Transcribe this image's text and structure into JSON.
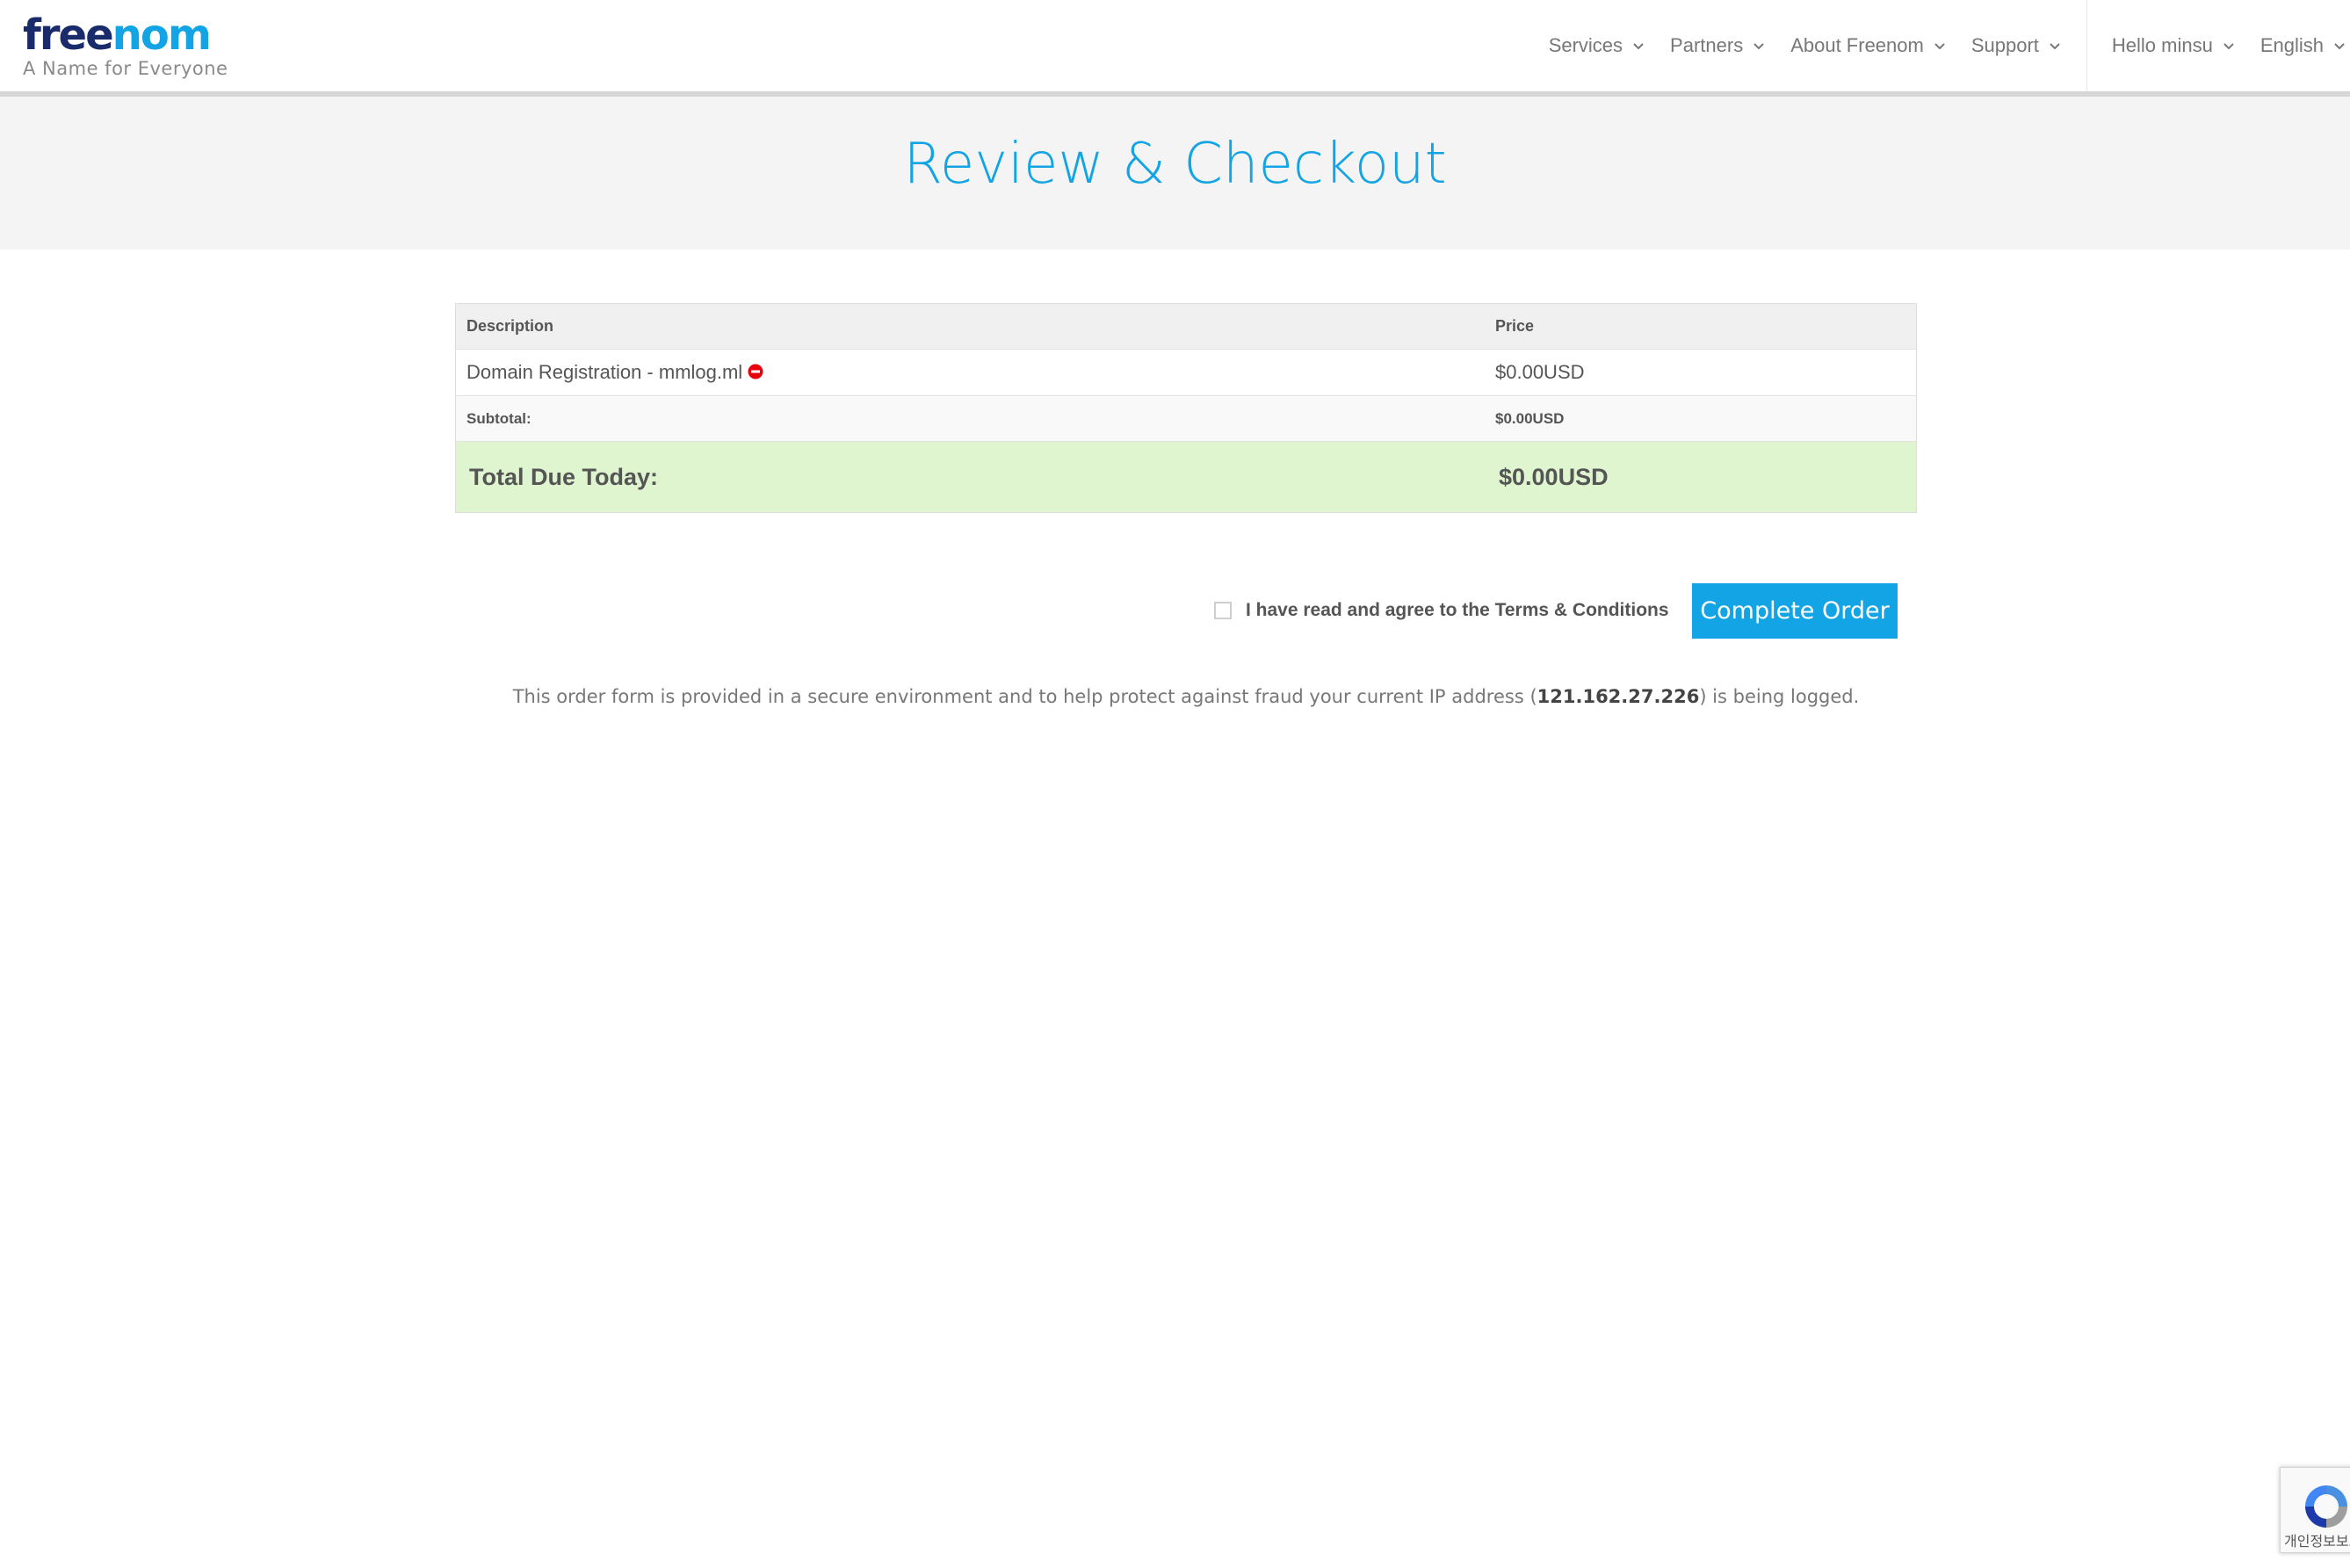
{
  "header": {
    "logo_part1": "free",
    "logo_part2": "nom",
    "tagline": "A Name for Everyone",
    "nav": [
      {
        "label": "Services"
      },
      {
        "label": "Partners"
      },
      {
        "label": "About Freenom"
      },
      {
        "label": "Support"
      }
    ],
    "user_menu": "Hello minsu",
    "language": "English"
  },
  "banner": {
    "title": "Review & Checkout"
  },
  "order": {
    "head": {
      "description": "Description",
      "price": "Price"
    },
    "items": [
      {
        "description": "Domain Registration - mmlog.ml",
        "price": "$0.00USD",
        "remove_icon": "remove-circle-icon"
      }
    ],
    "subtotal_label": "Subtotal:",
    "subtotal_value": "$0.00USD",
    "total_label": "Total Due Today:",
    "total_value": "$0.00USD"
  },
  "agree": {
    "checked": false,
    "text": "I have read and agree to the ",
    "link": "Terms & Conditions"
  },
  "complete_button": "Complete Order",
  "notice": {
    "before": "This order form is provided in a secure environment and to help protect against fraud your current IP address (",
    "ip": "121.162.27.226",
    "after": ") is being logged."
  },
  "recaptcha": {
    "text": "개인정보보호"
  },
  "colors": {
    "brand_blue": "#12a4e4",
    "brand_navy": "#1a2b6b",
    "total_bg": "#dff5cf",
    "remove_red": "#e8000b"
  }
}
